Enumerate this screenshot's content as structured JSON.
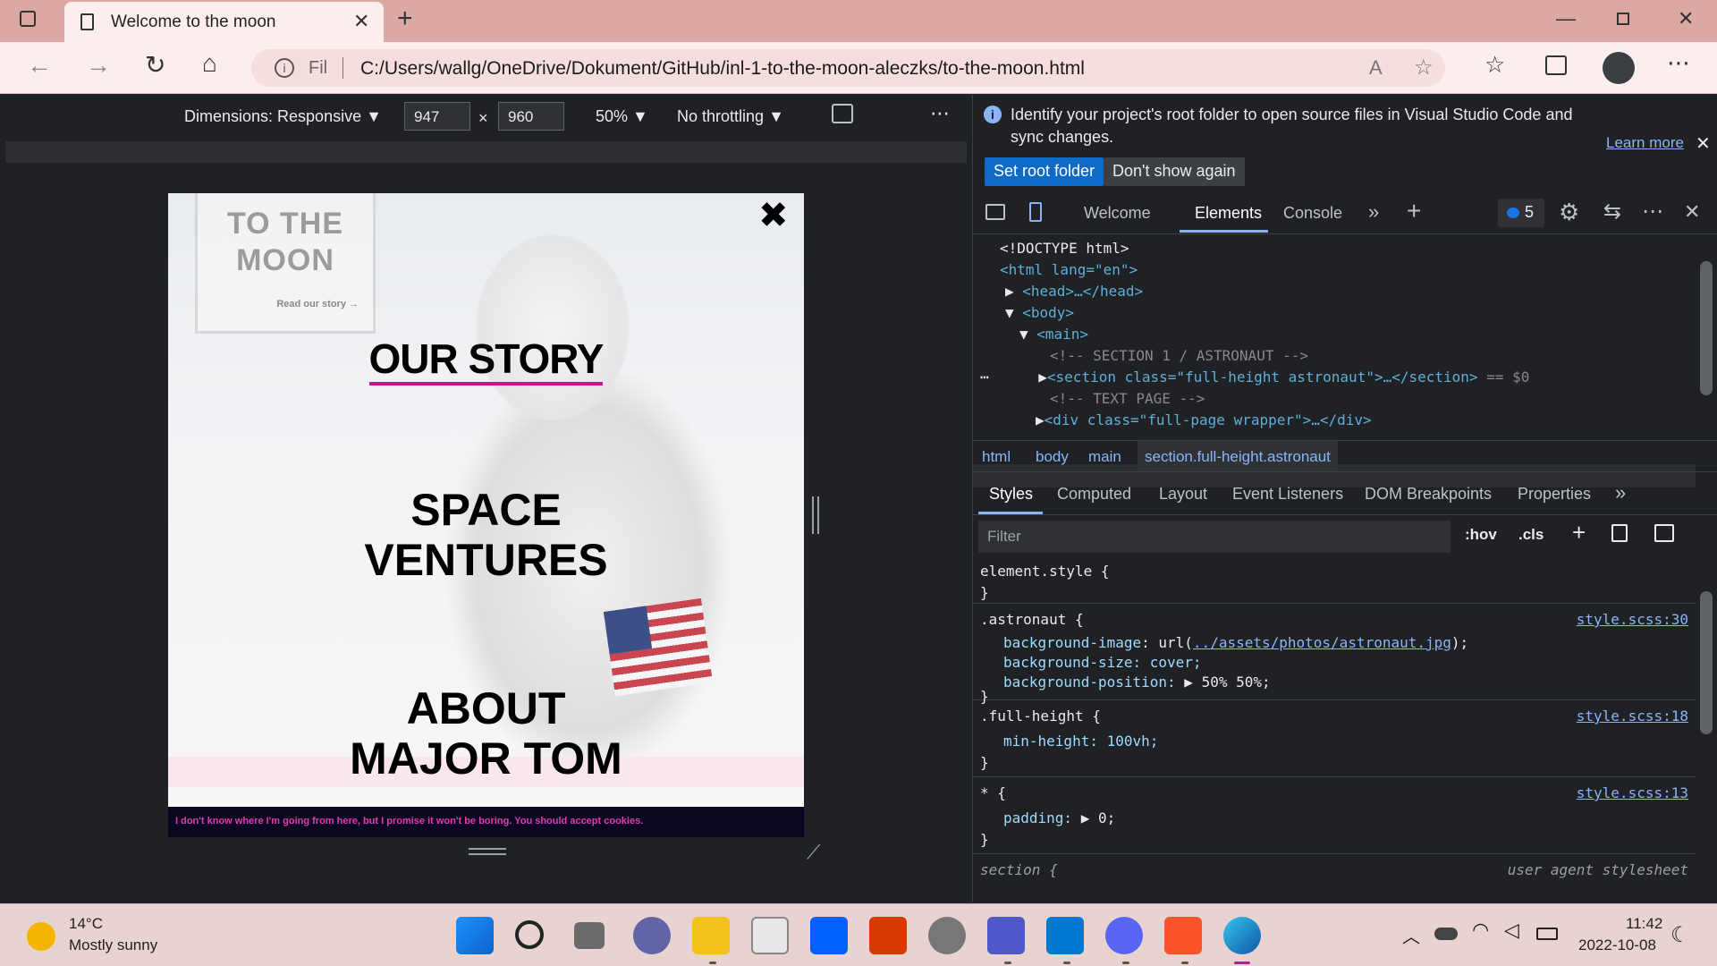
{
  "browser": {
    "tab_title": "Welcome to the moon",
    "new_tab": "+",
    "address_prefix": "Fil",
    "address_url": "C:/Users/wallg/OneDrive/Dokument/GitHub/inl-1-to-the-moon-aleczks/to-the-moon.html",
    "window_controls": [
      "minimize",
      "restore",
      "close"
    ]
  },
  "device_toolbar": {
    "dimensions_label": "Dimensions: Responsive",
    "width": "947",
    "times": "×",
    "height": "960",
    "zoom": "50%",
    "throttling": "No throttling"
  },
  "page": {
    "logo_line1": "TO THE",
    "logo_line2": "MOON",
    "read_story": "Read our story →",
    "close": "✖",
    "our_story": "OUR STORY",
    "space_line1": "SPACE",
    "space_line2": "VENTURES",
    "about_line1": "ABOUT",
    "about_line2": "MAJOR TOM",
    "cookie_text": "I don't know where I'm going from here, but I promise it won't be boring. You should accept cookies."
  },
  "devtools": {
    "info_message": "Identify your project's root folder to open source files in Visual Studio Code and sync changes.",
    "learn_more": "Learn more",
    "set_root": "Set root folder",
    "dont_show": "Don't show again",
    "tabs": [
      "Welcome",
      "Elements",
      "Console"
    ],
    "issues_count": "5",
    "dom": {
      "doctype": "<!DOCTYPE html>",
      "html_open": "<html lang=\"en\">",
      "head": "<head>…</head>",
      "body": "<body>",
      "main": "<main>",
      "comment1": "<!-- SECTION 1 / ASTRONAUT -->",
      "section": "<section class=\"full-height astronaut\">…</section>",
      "dollar0": "== $0",
      "comment2": "<!-- TEXT PAGE -->",
      "div": "<div class=\"full-page wrapper\">…</div>"
    },
    "breadcrumbs": [
      "html",
      "body",
      "main",
      "section.full-height.astronaut"
    ],
    "style_tabs": [
      "Styles",
      "Computed",
      "Layout",
      "Event Listeners",
      "DOM Breakpoints",
      "Properties"
    ],
    "filter_placeholder": "Filter",
    "hov": ":hov",
    "cls": ".cls",
    "rules": {
      "element_style": "element.style {",
      "close_brace": "}",
      "astronaut_sel": ".astronaut {",
      "astronaut_src": "style.scss:30",
      "bg_image_prop": "background-image",
      "bg_image_url": "../assets/photos/astronaut.jpg",
      "bg_size": "background-size: cover;",
      "bg_pos_prop": "background-position:",
      "bg_pos_val": "50% 50%;",
      "fullheight_sel": ".full-height {",
      "fullheight_src": "style.scss:18",
      "min_height": "min-height: 100vh;",
      "star_sel": "* {",
      "star_src": "style.scss:13",
      "padding_prop": "padding:",
      "padding_val": "0;",
      "section_sel": "section {",
      "section_src": "user agent stylesheet"
    }
  },
  "taskbar": {
    "temp": "14°C",
    "weather": "Mostly sunny",
    "time": "11:42",
    "date": "2022-10-08"
  },
  "colors": {
    "accent_pink": "#c2188f",
    "devtools_blue": "#0e6ac7",
    "titlebar": "#dba8a4"
  }
}
